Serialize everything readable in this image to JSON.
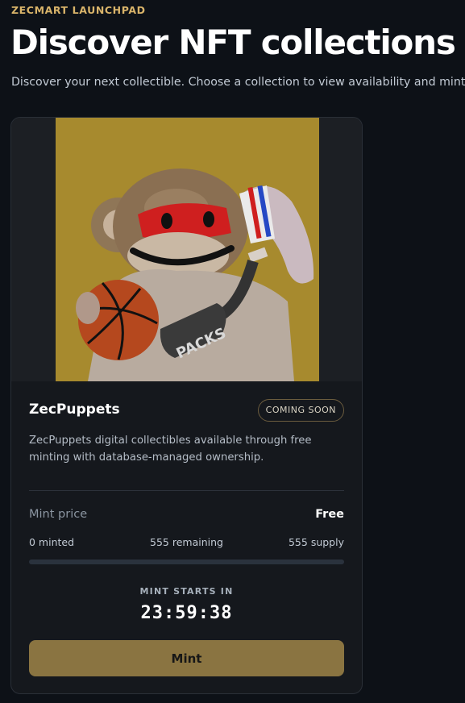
{
  "header": {
    "eyebrow": "ZECMART LAUNCHPAD",
    "title": "Discover NFT collections",
    "subtitle": "Discover your next collectible. Choose a collection to view availability and mint."
  },
  "collection": {
    "name": "ZecPuppets",
    "status": "COMING SOON",
    "description": "ZecPuppets digital collectibles available through free minting with database-managed ownership.",
    "price_label": "Mint price",
    "price_value": "Free",
    "minted": "0 minted",
    "remaining": "555 remaining",
    "supply": "555 supply",
    "progress_fraction": 0,
    "countdown_label": "MINT STARTS IN",
    "countdown": "23:59:38",
    "mint_button": "Mint",
    "image": {
      "subject": "puppet monkey holding basketball",
      "bag_text": "PACKS"
    }
  },
  "colors": {
    "background": "#0d1117",
    "accent": "#d9b46a",
    "button": "#8a7441",
    "art_background": "#a78a2e"
  }
}
